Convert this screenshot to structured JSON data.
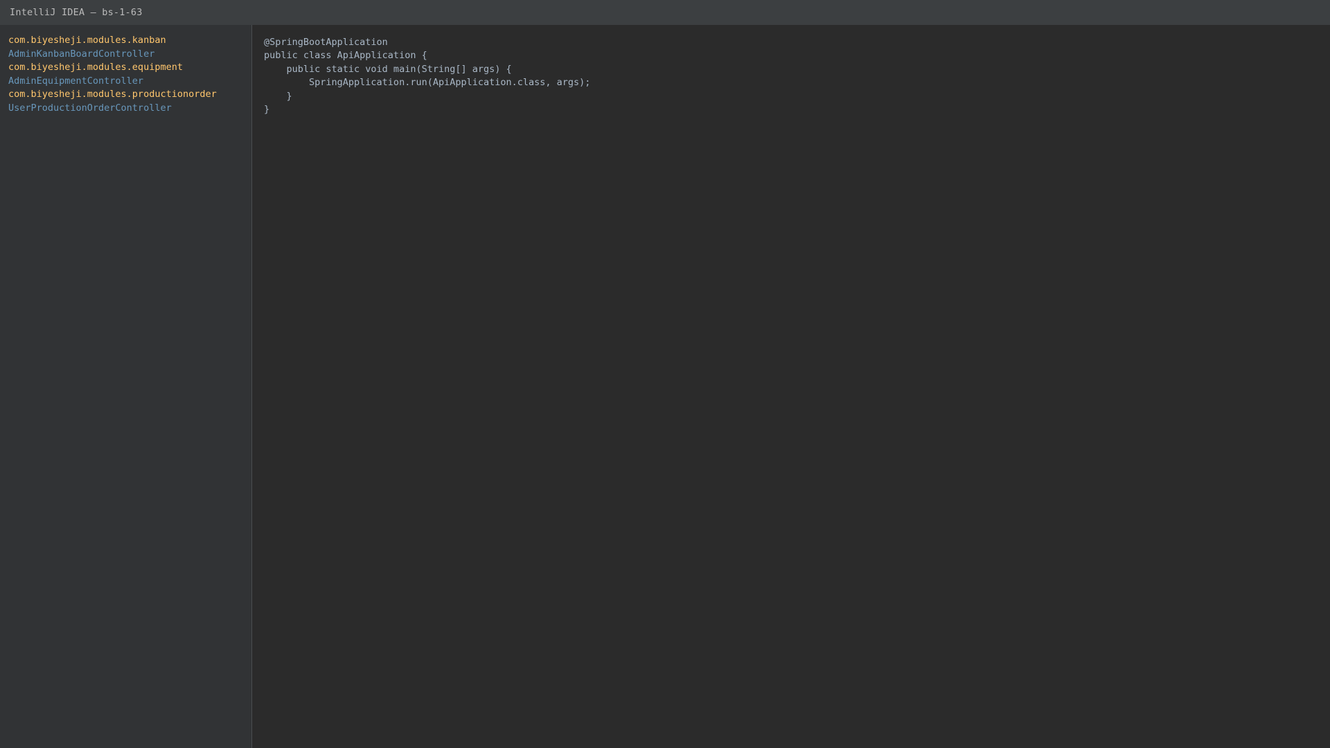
{
  "window": {
    "title": "IntelliJ IDEA — bs-1-63"
  },
  "project_tree": [
    {
      "label": "com.biyesheji.modules.kanban",
      "kind": "package"
    },
    {
      "label": "AdminKanbanBoardController",
      "kind": "class"
    },
    {
      "label": "com.biyesheji.modules.equipment",
      "kind": "package"
    },
    {
      "label": "AdminEquipmentController",
      "kind": "class"
    },
    {
      "label": "com.biyesheji.modules.productionorder",
      "kind": "package"
    },
    {
      "label": "UserProductionOrderController",
      "kind": "class"
    }
  ],
  "editor": {
    "lines": [
      "@SpringBootApplication",
      "public class ApiApplication {",
      "    public static void main(String[] args) {",
      "        SpringApplication.run(ApiApplication.class, args);",
      "    }",
      "}"
    ]
  },
  "colors": {
    "package": "#ffc66d",
    "class": "#6897bb",
    "code": "#a9b7c6",
    "editor_bg": "#2b2b2b",
    "sidebar_bg": "#313335",
    "titlebar_bg": "#3c3f41"
  }
}
